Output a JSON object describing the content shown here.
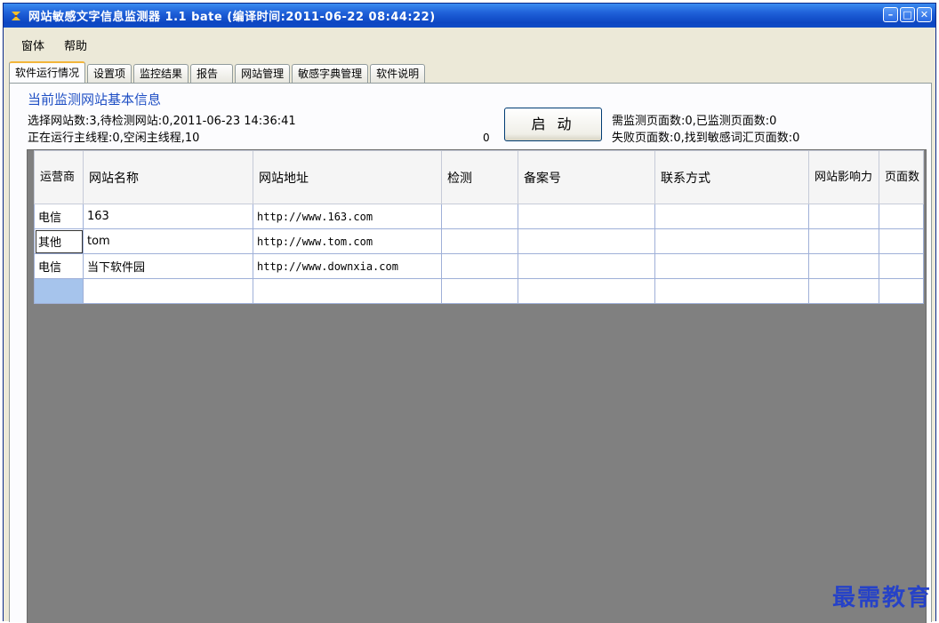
{
  "window": {
    "title": "网站敏感文字信息监测器 1.1 bate (编译时间:2011-06-22 08:44:22)",
    "controls": {
      "minimize": "–",
      "maximize": "□",
      "close": "✕"
    }
  },
  "menu": [
    "窗体",
    "帮助"
  ],
  "tabs": [
    "软件运行情况",
    "设置项",
    "监控结果",
    "报告",
    "网站管理",
    "敏感字典管理",
    "软件说明"
  ],
  "panel": {
    "group_title": "当前监测网站基本信息",
    "info_line1": "选择网站数:3,待检测网站:0,2011-06-23 14:36:41",
    "info_line2": "正在运行主线程:0,空闲主线程,10",
    "zero_label": "0",
    "start_button": "启 动",
    "info_right1": "需监测页面数:0,已监测页面数:0",
    "info_right2": "失败页面数:0,找到敏感词汇页面数:0"
  },
  "grid": {
    "columns": [
      "运营商",
      "网站名称",
      "网站地址",
      "检测",
      "备案号",
      "联系方式",
      "网站影响力",
      "页面数"
    ],
    "rows": [
      {
        "carrier": "电信",
        "name": "163",
        "url": "http://www.163.com"
      },
      {
        "carrier": "其他",
        "name": "tom",
        "url": "http://www.tom.com"
      },
      {
        "carrier": "电信",
        "name": "当下软件园",
        "url": "http://www.downxia.com"
      }
    ]
  },
  "watermark": "最需教育",
  "colors": {
    "title_bar": "#0d46c2",
    "group_title": "#1f4fc4",
    "grid_bg": "#808080",
    "watermark": "#2642c7"
  }
}
